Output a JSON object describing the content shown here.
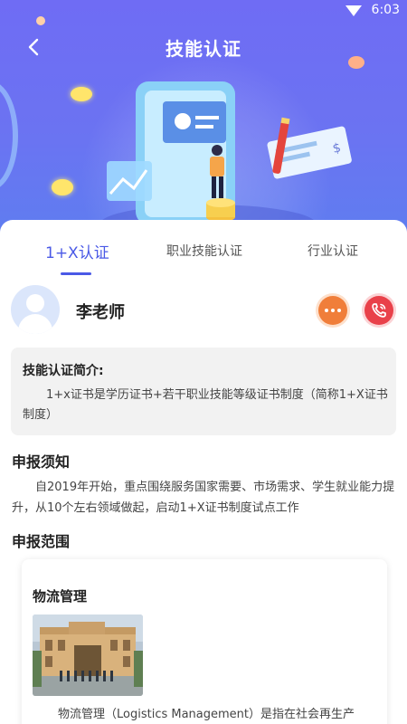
{
  "status_bar": {
    "time": "6:03"
  },
  "header": {
    "title": "技能认证"
  },
  "tabs": [
    {
      "label": "1+X认证",
      "active": true
    },
    {
      "label": "职业技能认证",
      "active": false
    },
    {
      "label": "行业认证",
      "active": false
    }
  ],
  "teacher": {
    "name": "李老师"
  },
  "intro": {
    "title": "技能认证简介:",
    "text": "1+x证书是学历证书+若干职业技能等级证书制度（简称1+X证书制度）"
  },
  "notice": {
    "title": "申报须知",
    "text": "自2019年开始，重点围绕服务国家需要、市场需求、学生就业能力提升，从10个左右领域做起，启动1+X证书制度试点工作"
  },
  "scope": {
    "title": "申报范围",
    "items": [
      {
        "name": "物流管理",
        "description": "物流管理（Logistics Management）是指在社会再生产"
      }
    ]
  },
  "colors": {
    "accent": "#4a59e6",
    "hero_top": "#6f6cf4",
    "message": "#f07e3a",
    "call": "#e9414a"
  },
  "icons": [
    "back-arrow-icon",
    "wifi-icon",
    "message-icon",
    "phone-icon",
    "avatar-placeholder-icon"
  ]
}
